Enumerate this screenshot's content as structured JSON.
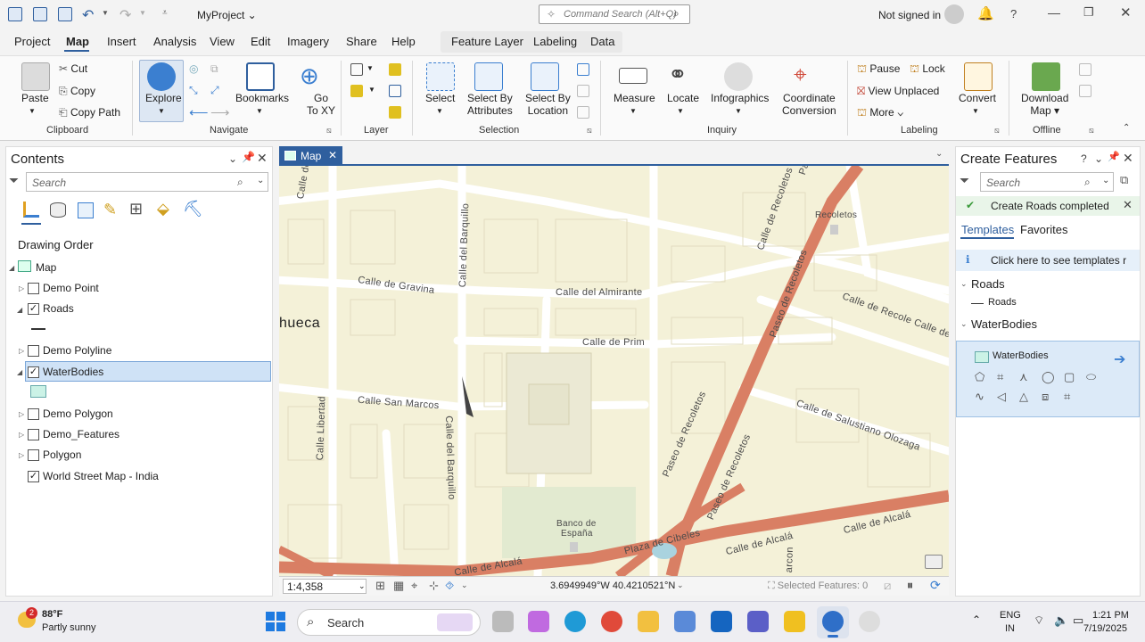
{
  "app": {
    "project": "MyProject",
    "command_search": "Command Search (Alt+Q)",
    "signed_in": "Not signed in"
  },
  "menu": [
    "Project",
    "Map",
    "Insert",
    "Analysis",
    "View",
    "Edit",
    "Imagery",
    "Share",
    "Help"
  ],
  "context_tabs": [
    "Feature Layer",
    "Labeling",
    "Data"
  ],
  "ribbon": {
    "clipboard": {
      "paste": "Paste",
      "cut": "Cut",
      "copy": "Copy",
      "copy_path": "Copy Path",
      "group": "Clipboard"
    },
    "navigate": {
      "explore": "Explore",
      "bookmarks": "Bookmarks",
      "go": "Go",
      "to_xy": "To XY",
      "group": "Navigate"
    },
    "layer": {
      "group": "Layer"
    },
    "selection": {
      "select": "Select",
      "select_by_attr_1": "Select By",
      "select_by_attr_2": "Attributes",
      "select_by_loc_1": "Select By",
      "select_by_loc_2": "Location",
      "group": "Selection"
    },
    "inquiry": {
      "measure": "Measure",
      "locate": "Locate",
      "infographics": "Infographics",
      "coord_1": "Coordinate",
      "coord_2": "Conversion",
      "group": "Inquiry"
    },
    "labeling": {
      "pause": "Pause",
      "lock": "Lock",
      "view_unplaced": "View Unplaced",
      "more": "More",
      "convert": "Convert",
      "group": "Labeling"
    },
    "offline": {
      "download_1": "Download",
      "download_2": "Map",
      "group": "Offline"
    }
  },
  "contents": {
    "title": "Contents",
    "search_placeholder": "Search",
    "drawing_order": "Drawing Order",
    "map": "Map",
    "layers": [
      {
        "name": "Demo Point",
        "checked": false
      },
      {
        "name": "Roads",
        "checked": true
      },
      {
        "name": "Demo Polyline",
        "checked": false
      },
      {
        "name": "WaterBodies",
        "checked": true
      },
      {
        "name": "Demo Polygon",
        "checked": false
      },
      {
        "name": "Demo_Features",
        "checked": false
      },
      {
        "name": "Polygon",
        "checked": false
      },
      {
        "name": "World Street Map - India",
        "checked": true
      }
    ]
  },
  "map_tab": {
    "label": "Map"
  },
  "map_labels": {
    "chueca": "hueca",
    "recoletos": "Recoletos",
    "banco1": "Banco de",
    "banco2": "España",
    "streets": [
      "Calle de San Grego",
      "Calle del Barquillo",
      "Calle de Gravina",
      "Calle del Almirante",
      "Calle de Prim",
      "Paseo de Recoletos",
      "Calle de Recoletos",
      "Calle de Recole Calle de",
      "Calle Libertad",
      "Calle San Marcos",
      "Calle del Barquillo",
      "Paseo de Recoletos",
      "Paseo de Recoletos",
      "Calle de Salustiano Olozaga",
      "Plaza de Cibeles",
      "Calle de Alcalá",
      "Calle de Alcalá",
      "Calle de Alcalá",
      "Paseo",
      "arcon"
    ]
  },
  "status": {
    "scale": "1:4,358",
    "coords": "3.6949949°W 40.4210521°N",
    "selected": "Selected Features: 0"
  },
  "create_features": {
    "title": "Create Features",
    "search_placeholder": "Search",
    "notice": "Create Roads completed",
    "tabs": [
      "Templates",
      "Favorites"
    ],
    "info": "Click here to see templates r",
    "roads_group": "Roads",
    "roads_item": "Roads",
    "water_group": "WaterBodies",
    "water_item": "WaterBodies"
  },
  "taskbar": {
    "temp": "88°F",
    "weather": "Partly sunny",
    "badge": "2",
    "search": "Search",
    "lang1": "ENG",
    "lang2": "IN",
    "time": "1:21 PM",
    "date": "7/19/2025"
  }
}
